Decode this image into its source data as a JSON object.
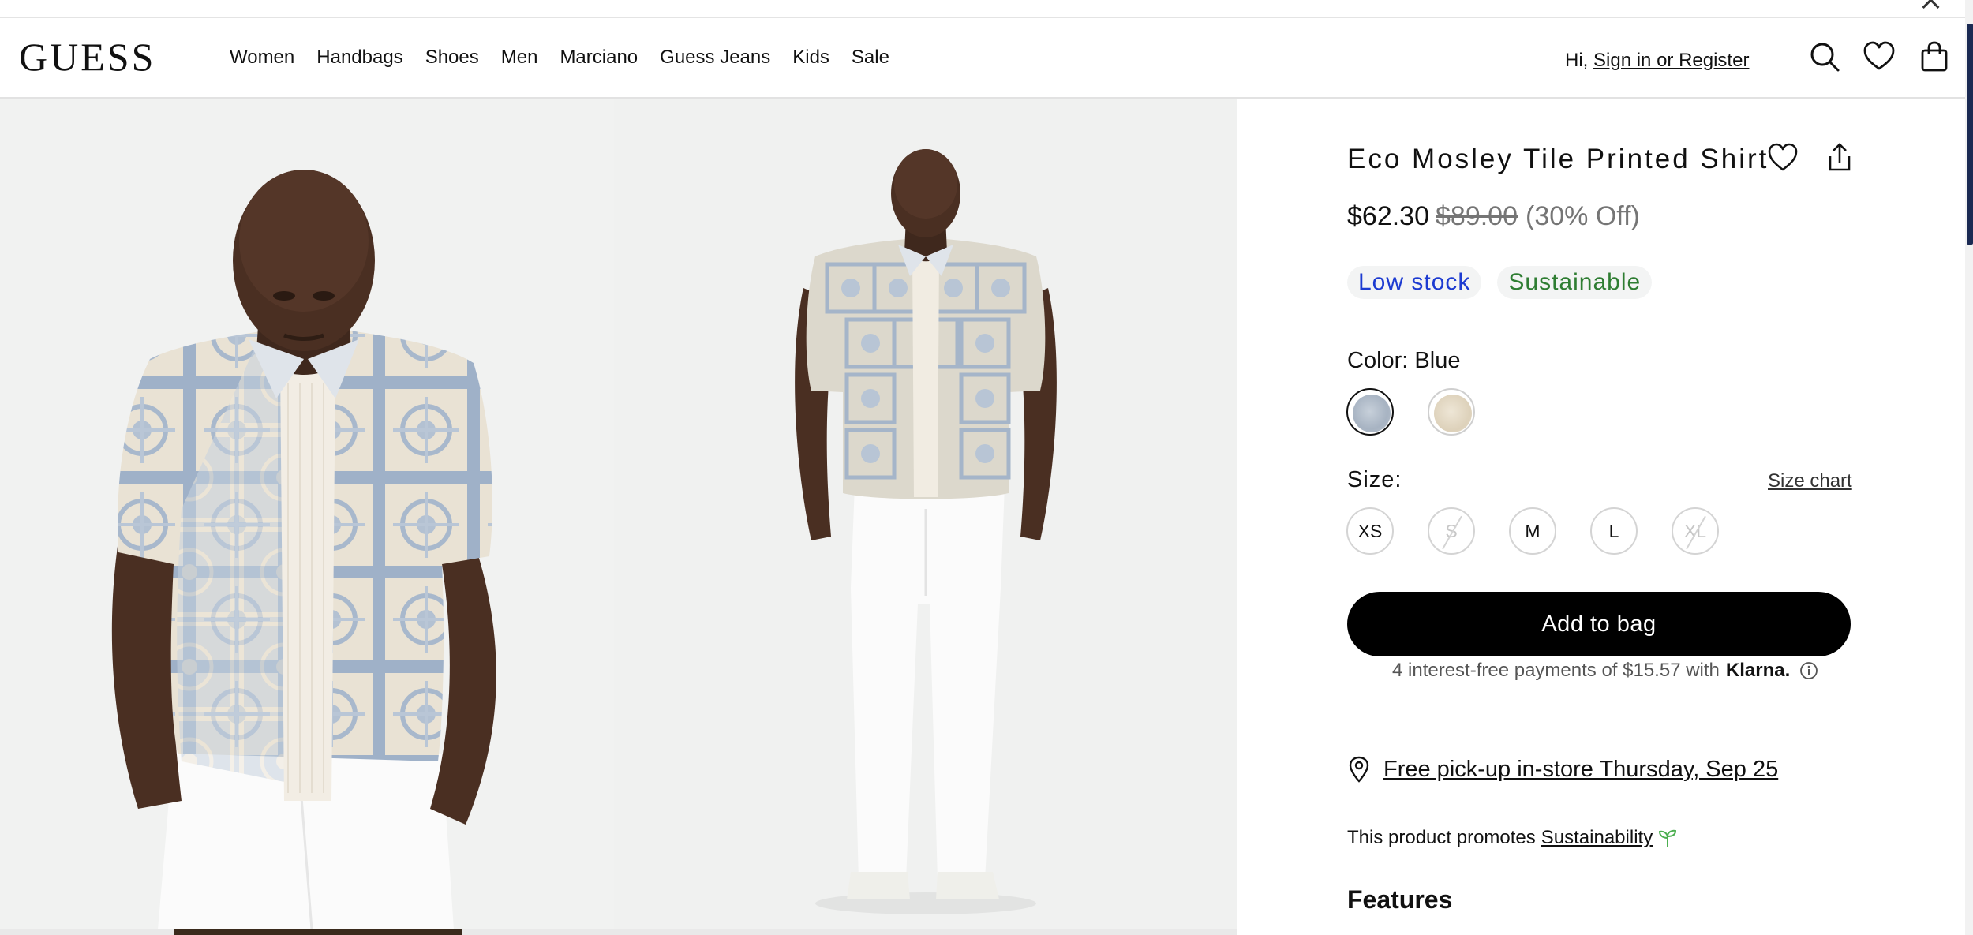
{
  "header": {
    "logo": "GUESS",
    "nav": [
      "Women",
      "Handbags",
      "Shoes",
      "Men",
      "Marciano",
      "Guess Jeans",
      "Kids",
      "Sale"
    ],
    "greeting": "Hi,",
    "signin": "Sign in or Register",
    "icons": [
      "search-icon",
      "heart-icon",
      "bag-icon"
    ]
  },
  "product": {
    "title": "Eco Mosley Tile Printed Shirt",
    "price_now": "$62.30",
    "price_was": "$89.00",
    "price_off": "(30% Off)",
    "badges": {
      "low_stock": "Low stock",
      "sustainable": "Sustainable"
    },
    "color_label": "Color: Blue",
    "colors": [
      {
        "name": "Blue",
        "hex": "#aab6c4",
        "selected": true
      },
      {
        "name": "Cream",
        "hex": "#e2d8c3",
        "selected": false
      }
    ],
    "size_label": "Size:",
    "size_chart": "Size chart",
    "sizes": [
      {
        "label": "XS",
        "available": true
      },
      {
        "label": "S",
        "available": false
      },
      {
        "label": "M",
        "available": true
      },
      {
        "label": "L",
        "available": true
      },
      {
        "label": "XL",
        "available": false
      }
    ],
    "add_to_bag": "Add to bag",
    "klarna_text": "4 interest-free payments of $15.57 with",
    "klarna_brand": "Klarna.",
    "pickup": "Free pick-up in-store Thursday, Sep 25",
    "promote_text": "This product promotes",
    "promote_link": "Sustainability",
    "features_heading": "Features"
  },
  "colors": {
    "accent_blue": "#1d3bd1",
    "sustain_green": "#2e7d32",
    "button_black": "#000000"
  }
}
